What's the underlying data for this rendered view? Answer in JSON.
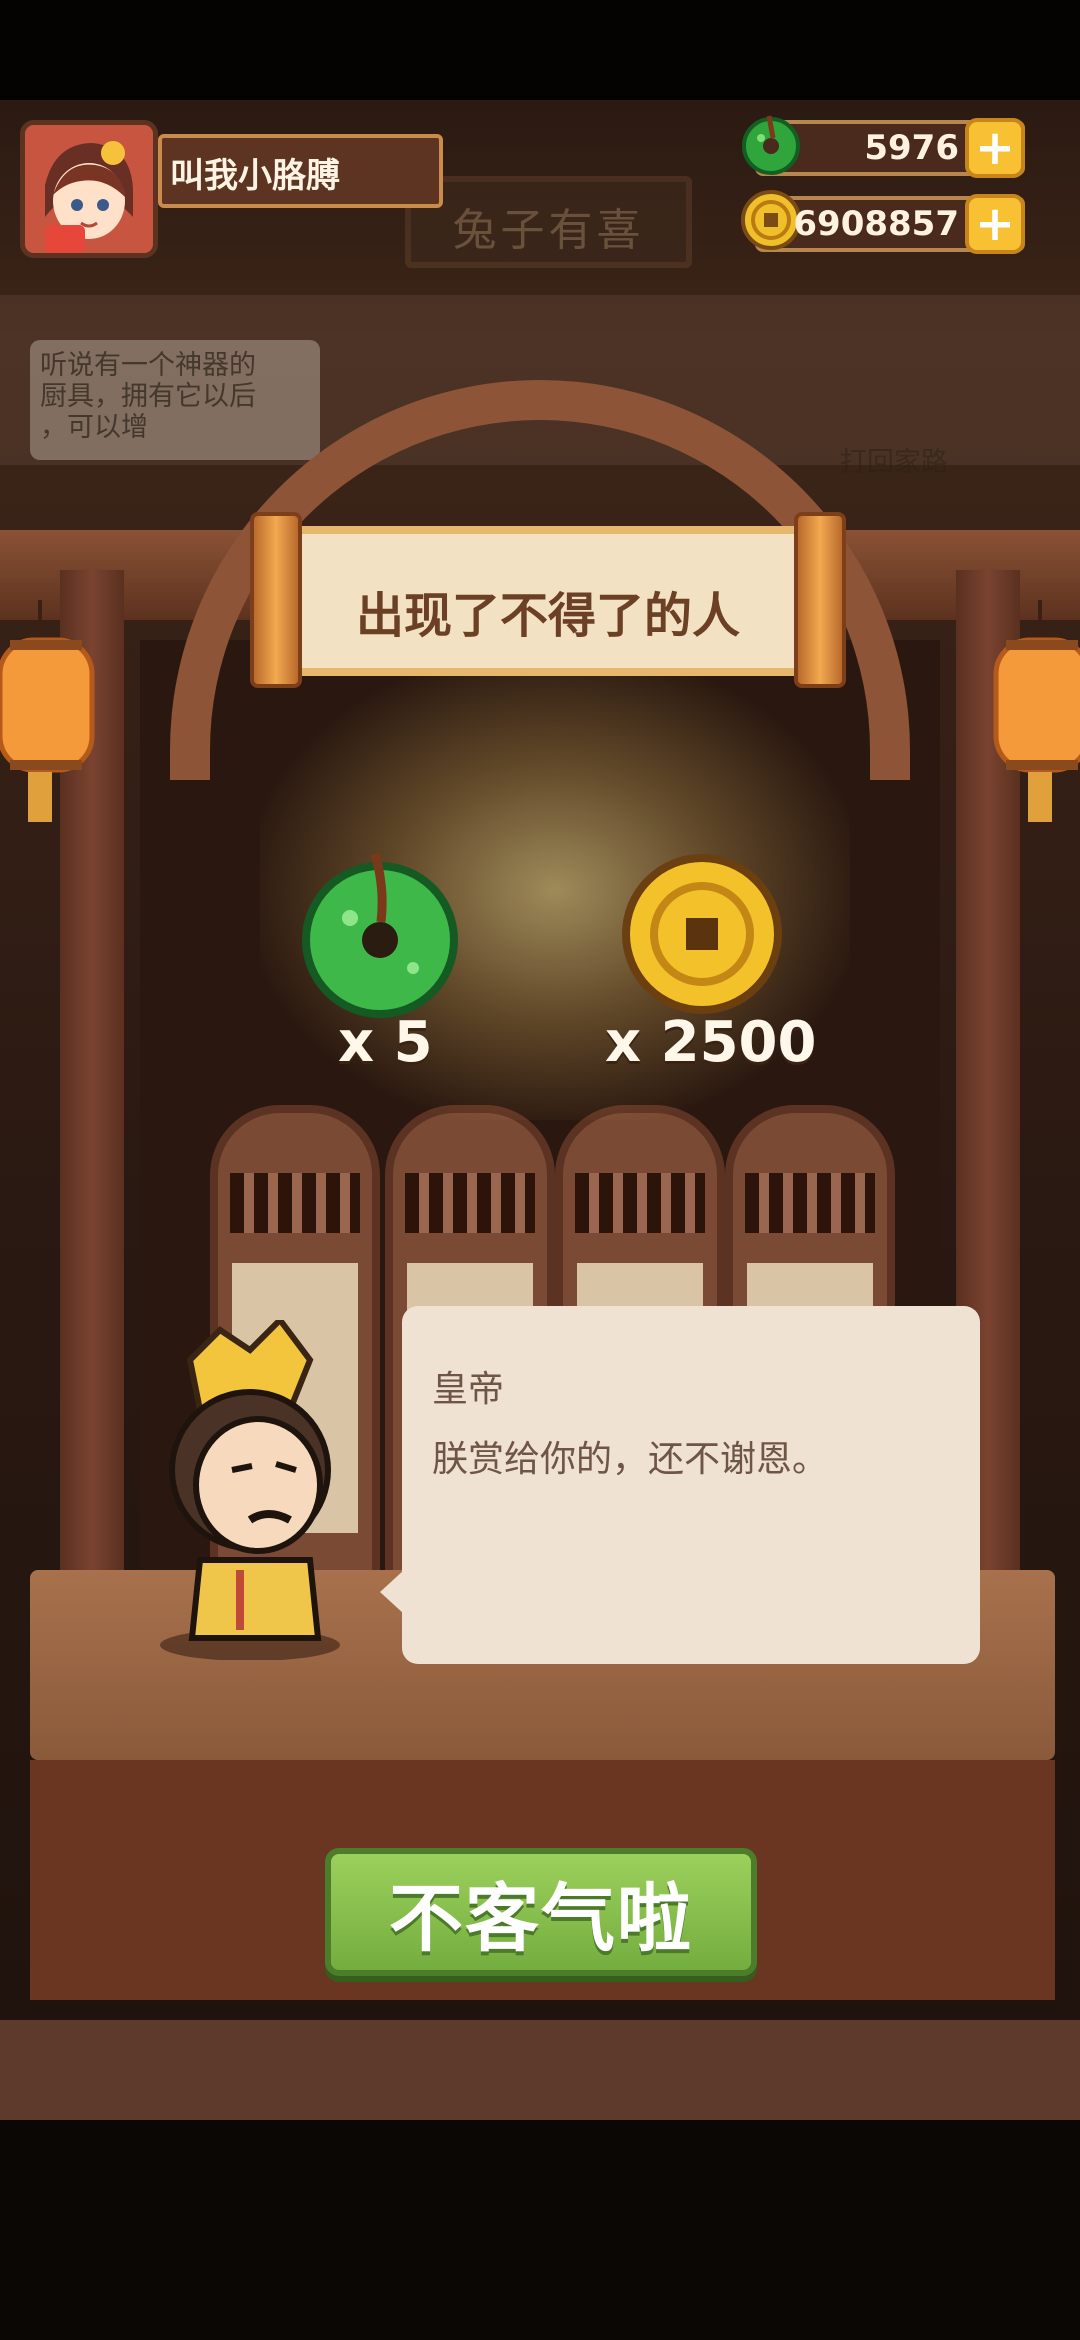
{
  "player": {
    "name": "叫我小胳膊"
  },
  "currencies": [
    {
      "type": "jade",
      "value": "5976",
      "color": "#2fa53b",
      "icon": "jade-icon"
    },
    {
      "type": "coin",
      "value": "6908857",
      "color": "#e8b21f",
      "icon": "coin-icon"
    }
  ],
  "background": {
    "sign": "兔子有喜",
    "hint_left": "听说有一个神器的\n厨具，拥有它以后\n，可以增",
    "hint_right": "打回家路"
  },
  "event": {
    "title": "出现了不得了的人"
  },
  "rewards": [
    {
      "item": "jade",
      "label": "x 5"
    },
    {
      "item": "coin",
      "label": "x 2500"
    }
  ],
  "dialog": {
    "speaker": "皇帝",
    "text": "朕赏给你的，还不谢恩。"
  },
  "confirm_button": {
    "label": "不客气啦"
  },
  "colors": {
    "accent_green": "#7cb648",
    "panel_beige": "#efe2d2",
    "wood": "#8d5437"
  }
}
